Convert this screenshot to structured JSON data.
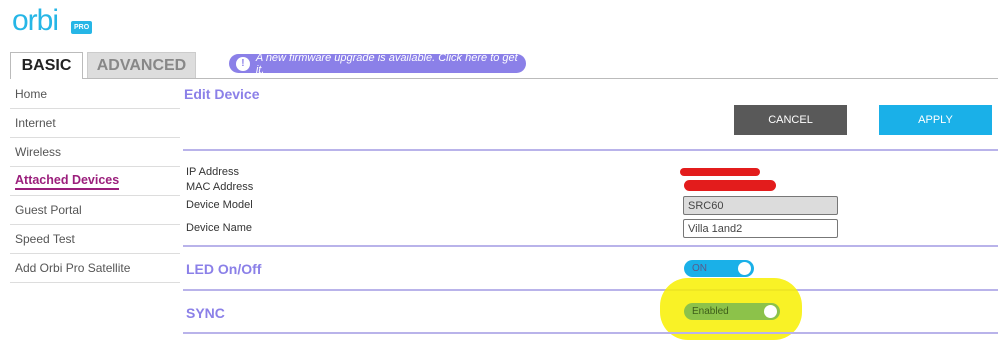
{
  "brand": {
    "logo": "orbi",
    "badge": "PRO"
  },
  "tabs": {
    "basic": "BASIC",
    "advanced": "ADVANCED"
  },
  "banner": {
    "icon": "!",
    "text": "A new firmware upgrade is available. Click here to get it."
  },
  "sidebar": {
    "items": [
      {
        "label": "Home"
      },
      {
        "label": "Internet"
      },
      {
        "label": "Wireless"
      },
      {
        "label": "Attached Devices"
      },
      {
        "label": "Guest Portal"
      },
      {
        "label": "Speed Test"
      },
      {
        "label": "Add Orbi Pro Satellite"
      }
    ],
    "active": "Attached Devices"
  },
  "page": {
    "title": "Edit Device"
  },
  "actions": {
    "cancel": "CANCEL",
    "apply": "APPLY"
  },
  "device": {
    "ip_label": "IP Address",
    "mac_label": "MAC Address",
    "model_label": "Device Model",
    "model_value": "SRC60",
    "name_label": "Device Name",
    "name_value": "Villa 1and2"
  },
  "led": {
    "title": "LED On/Off",
    "toggle": "ON"
  },
  "sync": {
    "title": "SYNC",
    "toggle": "Enabled"
  },
  "colors": {
    "accent": "#8b80e8",
    "brand": "#26b6e6",
    "apply": "#1ab0e8",
    "cancel": "#595959",
    "sync_on": "#8cc24a",
    "active_nav": "#9b1f7c",
    "redaction": "#e31c1c",
    "highlight": "#f8f000"
  }
}
